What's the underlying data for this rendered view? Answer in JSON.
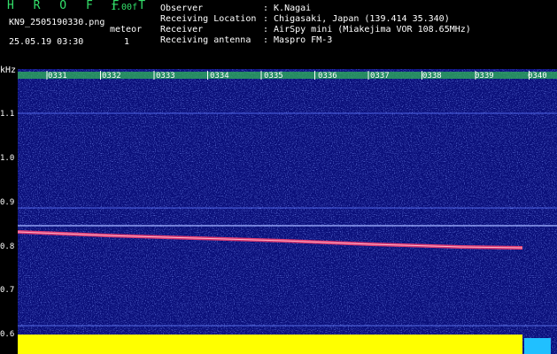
{
  "header": {
    "app_title": "H R O F F T",
    "version": "1.00f",
    "filename": "KN9_2505190330.png",
    "datetime": "25.05.19 03:30",
    "meteor_label": "meteor",
    "meteor_count": "1",
    "meta": [
      {
        "label": "Observer",
        "value": ": K.Nagai"
      },
      {
        "label": "Receiving Location",
        "value": ": Chigasaki, Japan (139.414 35.340)"
      },
      {
        "label": "Receiver",
        "value": ": AirSpy mini (Miakejima VOR 108.65MHz)"
      },
      {
        "label": "Receiving antenna",
        "value": ": Maspro FM-3"
      }
    ]
  },
  "spectrogram": {
    "y_unit": "kHz",
    "y_ticks": [
      "1.1",
      "1.0",
      "0.9",
      "0.8",
      "0.7",
      "0.6"
    ],
    "time_ticks": [
      "0331",
      "0332",
      "0333",
      "0334",
      "0335",
      "0336",
      "0337",
      "0338",
      "0339",
      "0340"
    ],
    "colors": {
      "background": "#0a0f7a",
      "noise_bright": "#3b52ff",
      "trace": "#ff4070",
      "signal_bar": "#ffff00",
      "time_band": "#2fb35a"
    }
  }
}
